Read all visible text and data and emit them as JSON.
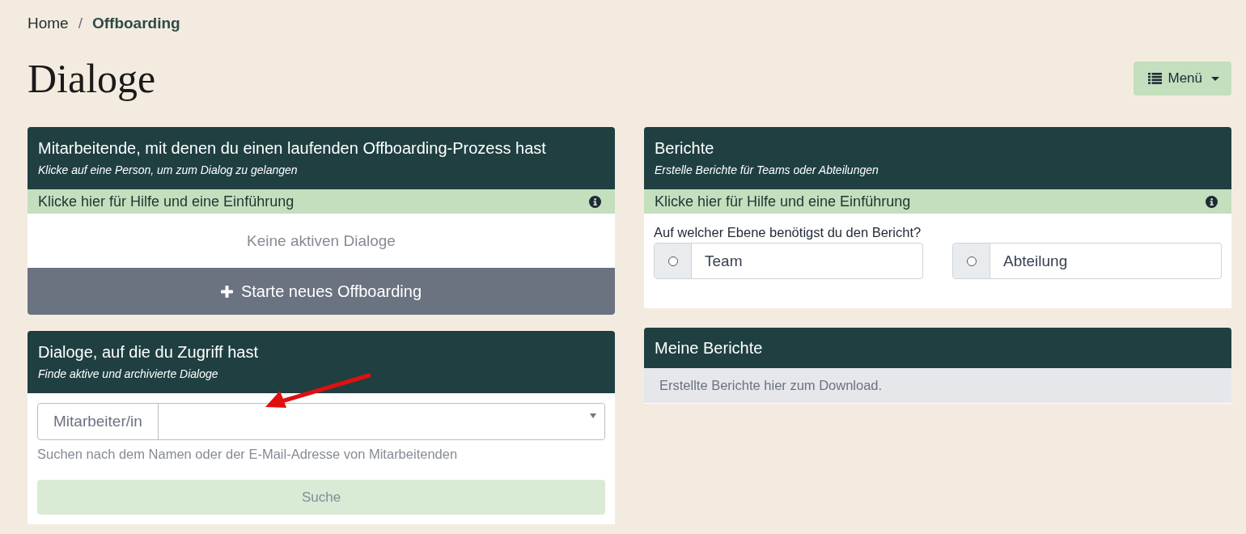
{
  "breadcrumb": [
    {
      "label": "Home",
      "current": false
    },
    {
      "label": "Offboarding",
      "current": true
    }
  ],
  "breadcrumb_separator": "/",
  "page_title": "Dialoge",
  "menu_button": {
    "label": "Menü"
  },
  "left_panels": [
    {
      "kind": "active",
      "title": "Mitarbeitende, mit denen du einen laufenden Offboarding-Prozess hast",
      "subtitle": "Klicke auf eine Person, um zum Dialog zu gelangen",
      "help": "Klicke hier für Hilfe und eine Einführung",
      "empty_text": "Keine aktiven Dialoge",
      "action": "Starte neues Offboarding"
    },
    {
      "kind": "search",
      "title": "Dialoge, auf die du Zugriff hast",
      "subtitle": "Finde aktive und archivierte Dialoge",
      "field_label": "Mitarbeiter/in",
      "hint": "Suchen nach dem Namen oder der E-Mail-Adresse von Mitarbeitenden",
      "button": {
        "label": "Suche",
        "disabled": true
      }
    }
  ],
  "right_panels": [
    {
      "kind": "reports",
      "title": "Berichte",
      "subtitle": "Erstelle Berichte für Teams oder Abteilungen",
      "help": "Klicke hier für Hilfe und eine Einführung",
      "question": "Auf welcher Ebene benötigst du den Bericht?",
      "options": [
        {
          "label": "Team",
          "selected": false
        },
        {
          "label": "Abteilung",
          "selected": false
        }
      ]
    },
    {
      "kind": "downloads",
      "title": "Meine Berichte",
      "note": "Erstellte Berichte hier zum Download."
    }
  ]
}
